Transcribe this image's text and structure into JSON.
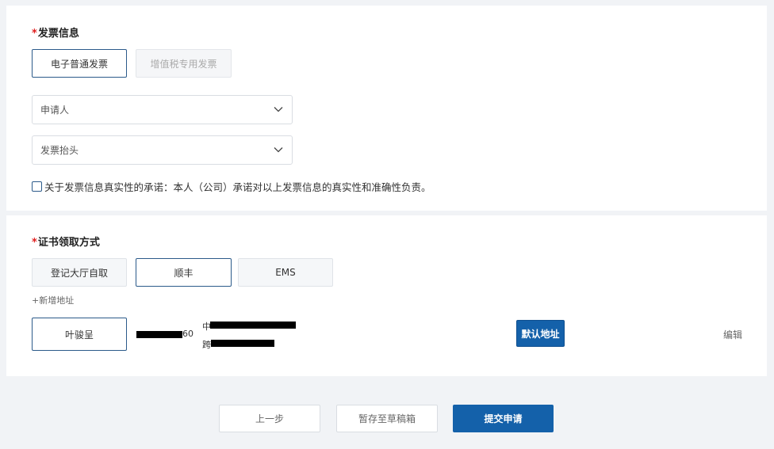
{
  "invoice": {
    "required_mark": "*",
    "title": "发票信息",
    "types": [
      {
        "label": "电子普通发票",
        "state": "selected"
      },
      {
        "label": "增值税专用发票",
        "state": "disabled"
      }
    ],
    "applicant_select": {
      "placeholder": "申请人",
      "icon": "chevron-down-icon"
    },
    "header_select": {
      "placeholder": "发票抬头",
      "icon": "chevron-down-icon"
    },
    "agreement_text": "关于发票信息真实性的承诺：本人（公司）承诺对以上发票信息的真实性和准确性负责。",
    "agreement_checked": false
  },
  "certificate": {
    "required_mark": "*",
    "title": "证书领取方式",
    "methods": [
      {
        "label": "登记大厅自取",
        "state": "normal"
      },
      {
        "label": "顺丰",
        "state": "selected"
      },
      {
        "label": "EMS",
        "state": "normal"
      }
    ],
    "add_address_label": "+新增地址",
    "address": {
      "name": "叶骏呈",
      "phone_suffix": "60",
      "line1_prefix": "中",
      "line2_prefix": "跨",
      "default_badge": "默认地址",
      "edit_label": "编辑"
    }
  },
  "footer": {
    "prev_label": "上一步",
    "draft_label": "暂存至草稿箱",
    "submit_label": "提交申请"
  },
  "colors": {
    "accent": "#1461aa",
    "selected_border": "#2b5a8a",
    "required": "#e02020",
    "page_bg": "#f1f3f6"
  }
}
